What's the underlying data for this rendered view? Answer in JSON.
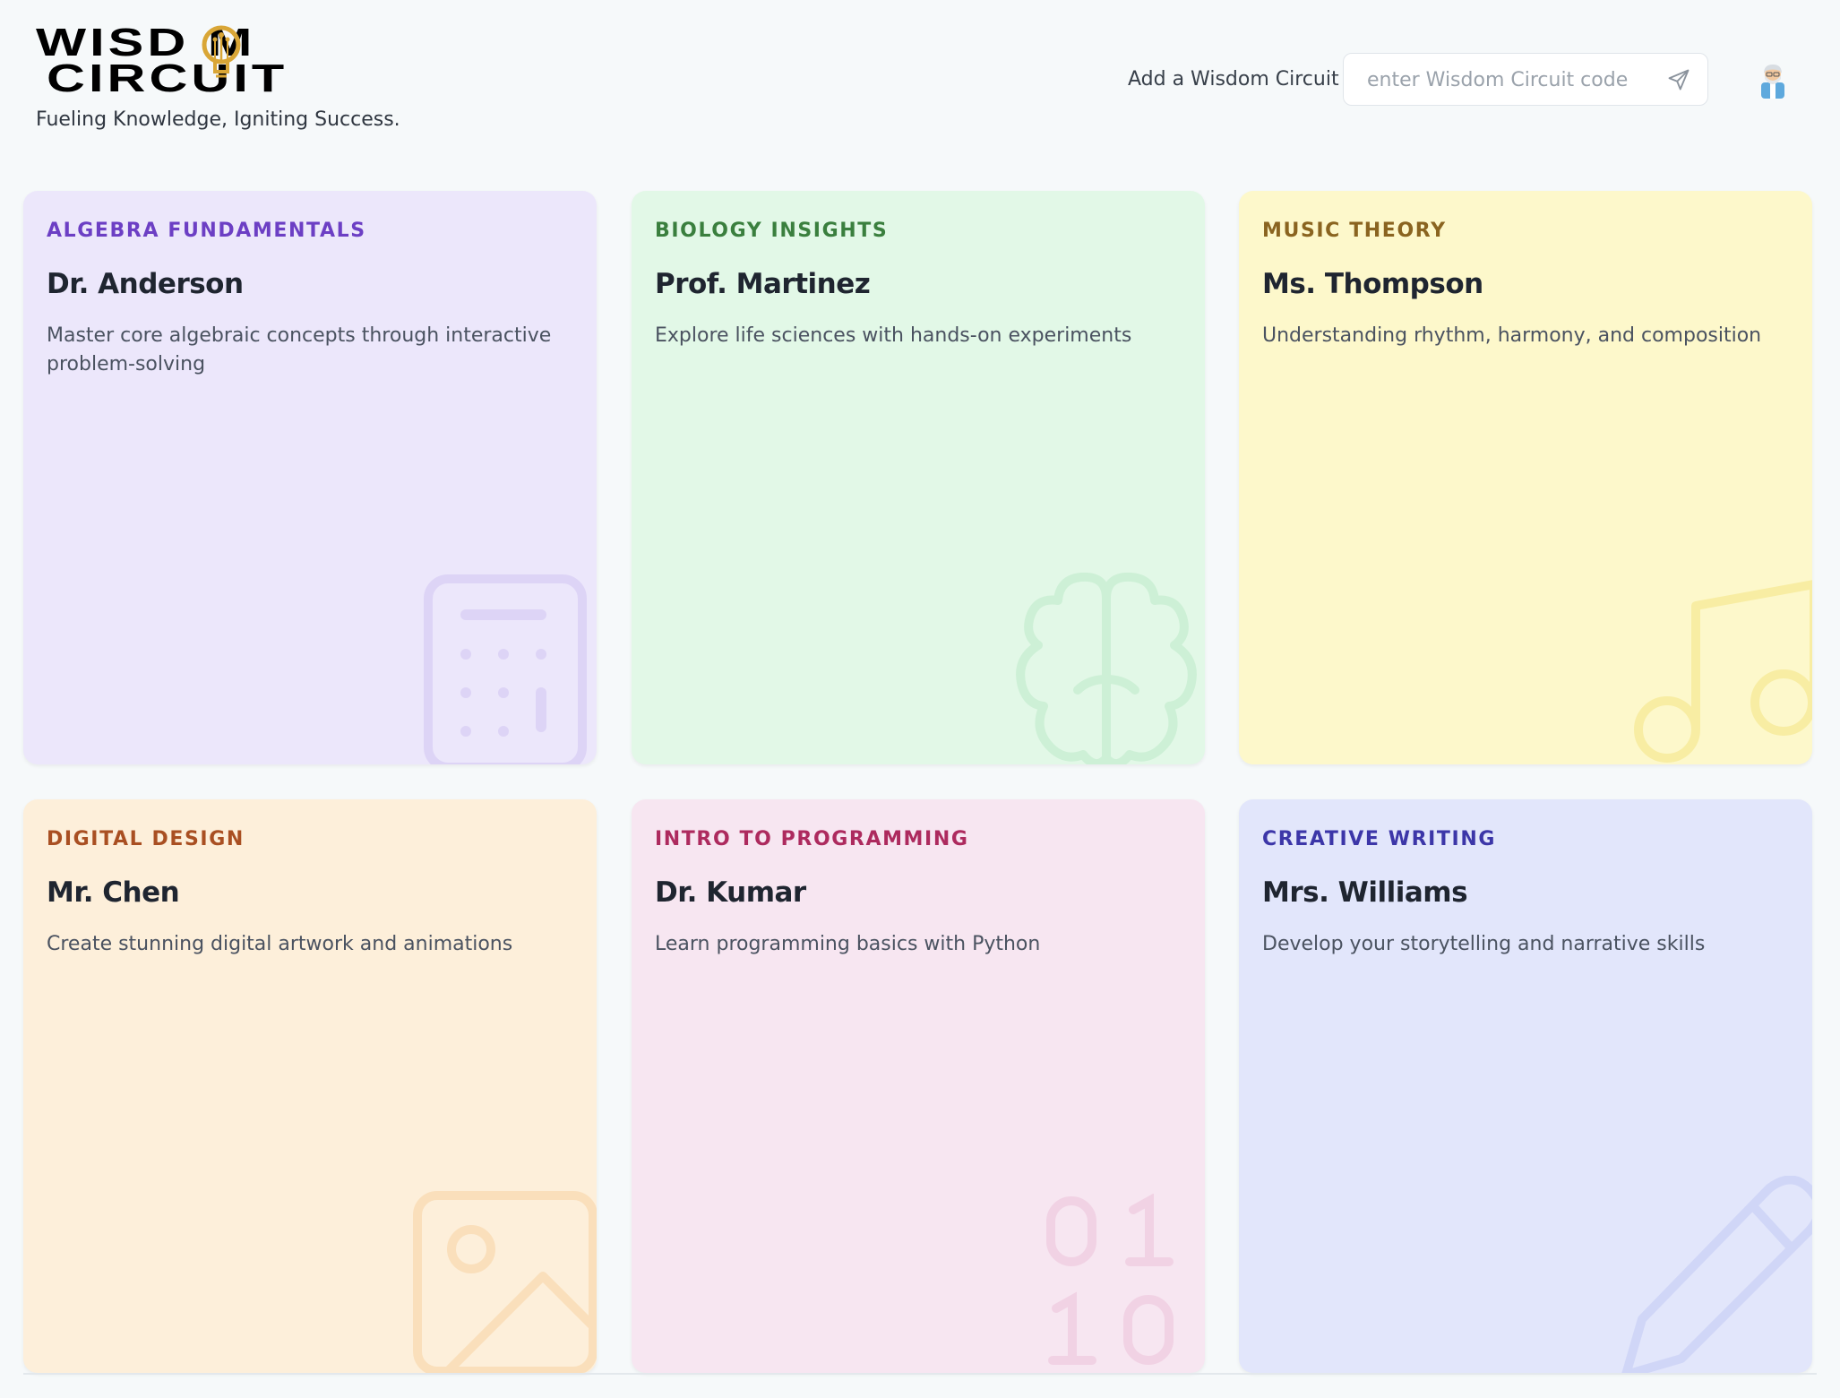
{
  "header": {
    "logo_line1": "WISD  M",
    "logo_line2": "CIRCUIT",
    "logo_alt": "WISDOM CIRCUIT",
    "tagline": "Fueling Knowledge, Igniting Success.",
    "add_label": "Add a Wisdom Circuit",
    "code_placeholder": "enter Wisdom Circuit code",
    "code_value": "",
    "send_icon": "send-icon",
    "avatar_icon": "scientist-avatar-icon"
  },
  "cards": [
    {
      "subject": "ALGEBRA FUNDAMENTALS",
      "teacher": "Dr. Anderson",
      "description": "Master core algebraic concepts through interactive problem-solving",
      "bg": "#ece7fb",
      "accent": "#6c3fc4",
      "icon": "calculator-icon"
    },
    {
      "subject": "BIOLOGY INSIGHTS",
      "teacher": "Prof. Martinez",
      "description": "Explore life sciences with hands-on experiments",
      "bg": "#e2f8e7",
      "accent": "#3a7f3e",
      "icon": "brain-icon"
    },
    {
      "subject": "MUSIC THEORY",
      "teacher": "Ms. Thompson",
      "description": "Understanding rhythm, harmony, and composition",
      "bg": "#fdf8cb",
      "accent": "#8a6420",
      "icon": "music-note-icon"
    },
    {
      "subject": "DIGITAL DESIGN",
      "teacher": "Mr. Chen",
      "description": "Create stunning digital artwork and animations",
      "bg": "#fdefda",
      "accent": "#a94f22",
      "icon": "image-icon"
    },
    {
      "subject": "INTRO TO PROGRAMMING",
      "teacher": "Dr. Kumar",
      "description": "Learn programming basics with Python",
      "bg": "#f7e6f1",
      "accent": "#ad2a5e",
      "icon": "binary-icon"
    },
    {
      "subject": "CREATIVE WRITING",
      "teacher": "Mrs. Williams",
      "description": "Develop your storytelling and narrative skills",
      "bg": "#e2e6fb",
      "accent": "#3c36a8",
      "icon": "pencil-icon"
    }
  ]
}
